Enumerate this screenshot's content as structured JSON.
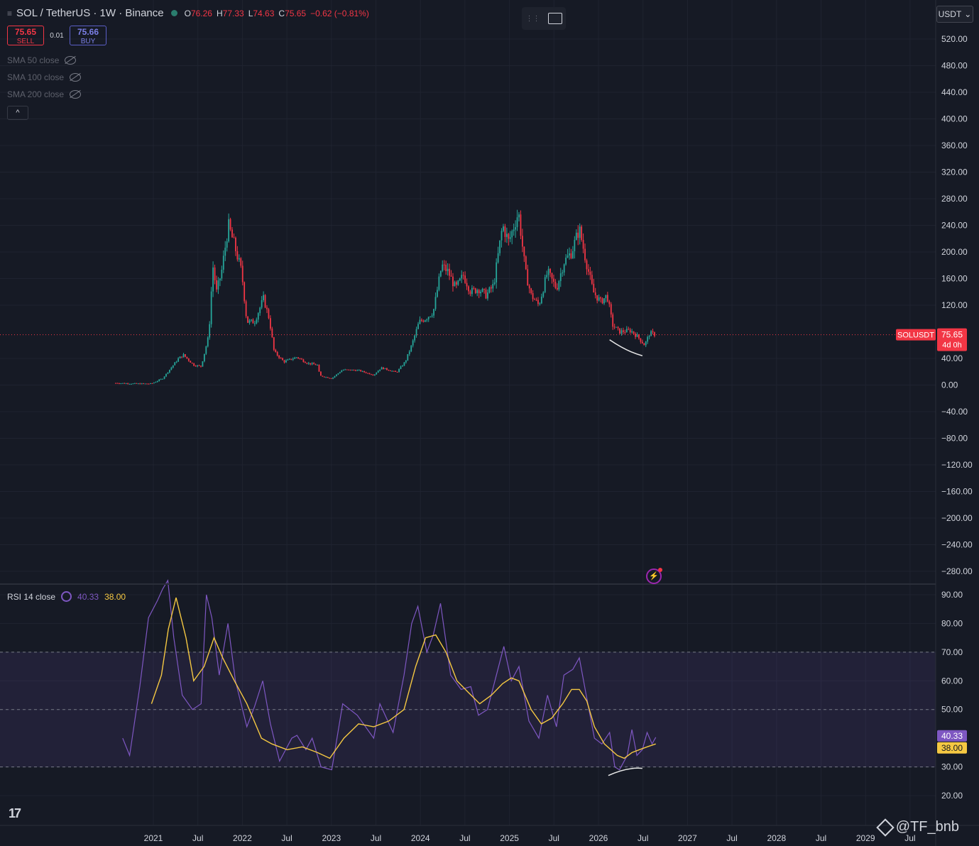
{
  "header": {
    "symbol": "SOL / TetherUS · 1W · Binance",
    "open_label": "O",
    "open": "76.26",
    "high_label": "H",
    "high": "77.33",
    "low_label": "L",
    "low": "74.63",
    "close_label": "C",
    "close": "75.65",
    "change": "−0.62 (−0.81%)"
  },
  "trade": {
    "sell_price": "75.65",
    "sell_label": "SELL",
    "spread": "0.01",
    "buy_price": "75.66",
    "buy_label": "BUY"
  },
  "indicators": [
    {
      "label": "SMA 50 close"
    },
    {
      "label": "SMA 100 close"
    },
    {
      "label": "SMA 200 close"
    }
  ],
  "collapse_glyph": "^",
  "currency": "USDT",
  "currency_glyph": "⌄",
  "rsi_header": {
    "name": "RSI 14 close",
    "value": "40.33",
    "ma_value": "38.00"
  },
  "price_tag": {
    "symbol": "SOLUSDT",
    "price": "75.65",
    "countdown": "4d 0h"
  },
  "watermark": "@TF_bnb",
  "tv_logo": "17",
  "colors": {
    "up": "#26a69a",
    "down": "#f23645",
    "rsi": "#7e57c2",
    "rsi_ma": "#f5c842",
    "bg": "#161a25"
  },
  "chart_data": [
    {
      "type": "candlestick",
      "axis": {
        "price_ticks": [
          "520.00",
          "480.00",
          "440.00",
          "400.00",
          "360.00",
          "320.00",
          "280.00",
          "240.00",
          "200.00",
          "160.00",
          "120.00",
          "40.00",
          "0.00",
          "−40.00",
          "−80.00",
          "−120.00",
          "−160.00",
          "−200.00",
          "−240.00",
          "−280.00"
        ],
        "ylim": [
          -300,
          540
        ],
        "time_ticks": [
          "2021",
          "Jul",
          "2022",
          "Jul",
          "2023",
          "Jul",
          "2024",
          "Jul",
          "2025",
          "Jul",
          "2026",
          "Jul",
          "2027",
          "Jul",
          "2028",
          "Jul",
          "2029",
          "Jul"
        ]
      },
      "x_start": "2020-08-10",
      "x_end": "2030-01-01",
      "weekly_close_anchors": [
        [
          "2020-08-10",
          3
        ],
        [
          "2020-11-01",
          2
        ],
        [
          "2021-01-01",
          2
        ],
        [
          "2021-02-15",
          10
        ],
        [
          "2021-04-20",
          40
        ],
        [
          "2021-05-10",
          45
        ],
        [
          "2021-06-20",
          30
        ],
        [
          "2021-07-20",
          28
        ],
        [
          "2021-08-20",
          75
        ],
        [
          "2021-09-05",
          180
        ],
        [
          "2021-09-20",
          140
        ],
        [
          "2021-10-10",
          170
        ],
        [
          "2021-11-07",
          240
        ],
        [
          "2021-12-01",
          210
        ],
        [
          "2021-12-30",
          170
        ],
        [
          "2022-01-20",
          95
        ],
        [
          "2022-02-20",
          95
        ],
        [
          "2022-03-28",
          130
        ],
        [
          "2022-04-20",
          100
        ],
        [
          "2022-05-10",
          50
        ],
        [
          "2022-06-18",
          35
        ],
        [
          "2022-08-10",
          42
        ],
        [
          "2022-09-20",
          33
        ],
        [
          "2022-11-01",
          30
        ],
        [
          "2022-11-10",
          14
        ],
        [
          "2022-12-28",
          10
        ],
        [
          "2023-02-10",
          23
        ],
        [
          "2023-04-15",
          22
        ],
        [
          "2023-06-15",
          15
        ],
        [
          "2023-07-15",
          26
        ],
        [
          "2023-09-15",
          19
        ],
        [
          "2023-10-20",
          35
        ],
        [
          "2023-11-15",
          60
        ],
        [
          "2023-12-15",
          95
        ],
        [
          "2024-01-10",
          100
        ],
        [
          "2024-02-10",
          110
        ],
        [
          "2024-03-15",
          180
        ],
        [
          "2024-04-10",
          170
        ],
        [
          "2024-05-10",
          145
        ],
        [
          "2024-06-10",
          165
        ],
        [
          "2024-07-10",
          140
        ],
        [
          "2024-08-10",
          145
        ],
        [
          "2024-09-10",
          135
        ],
        [
          "2024-10-10",
          150
        ],
        [
          "2024-11-15",
          240
        ],
        [
          "2024-12-10",
          215
        ],
        [
          "2025-01-18",
          260
        ],
        [
          "2025-02-15",
          170
        ],
        [
          "2025-03-10",
          135
        ],
        [
          "2025-04-10",
          120
        ],
        [
          "2025-05-15",
          170
        ],
        [
          "2025-06-20",
          145
        ],
        [
          "2025-07-20",
          185
        ],
        [
          "2025-08-20",
          200
        ],
        [
          "2025-09-20",
          235
        ],
        [
          "2025-10-15",
          190
        ],
        [
          "2025-11-15",
          140
        ],
        [
          "2025-12-15",
          125
        ],
        [
          "2026-01-10",
          135
        ],
        [
          "2026-02-01",
          90
        ],
        [
          "2026-03-01",
          80
        ],
        [
          "2026-04-15",
          82
        ],
        [
          "2026-05-15",
          72
        ],
        [
          "2026-06-10",
          60
        ],
        [
          "2026-07-01",
          78
        ],
        [
          "2026-07-25",
          75.65
        ]
      ],
      "annotation": "trendline below recent lows"
    },
    {
      "type": "line",
      "title": "RSI 14 close",
      "axis": {
        "ticks": [
          "90.00",
          "80.00",
          "70.00",
          "60.00",
          "50.00",
          "30.00",
          "20.00"
        ],
        "ylim": [
          14,
          94
        ],
        "bands": [
          30,
          50,
          70
        ]
      },
      "series": [
        {
          "name": "RSI",
          "color": "#7e57c2",
          "points": [
            [
              "2020-09-07",
              40
            ],
            [
              "2020-10-05",
              34
            ],
            [
              "2020-11-15",
              58
            ],
            [
              "2020-12-20",
              82
            ],
            [
              "2021-01-25",
              88
            ],
            [
              "2021-02-15",
              92
            ],
            [
              "2021-03-08",
              95
            ],
            [
              "2021-04-01",
              75
            ],
            [
              "2021-05-05",
              55
            ],
            [
              "2021-06-15",
              50
            ],
            [
              "2021-07-20",
              52
            ],
            [
              "2021-08-10",
              90
            ],
            [
              "2021-09-01",
              82
            ],
            [
              "2021-10-01",
              62
            ],
            [
              "2021-11-05",
              80
            ],
            [
              "2021-12-05",
              60
            ],
            [
              "2022-01-20",
              44
            ],
            [
              "2022-02-20",
              51
            ],
            [
              "2022-03-25",
              60
            ],
            [
              "2022-04-25",
              45
            ],
            [
              "2022-06-01",
              32
            ],
            [
              "2022-07-20",
              40
            ],
            [
              "2022-08-10",
              41
            ],
            [
              "2022-09-15",
              36
            ],
            [
              "2022-10-10",
              40
            ],
            [
              "2022-11-15",
              30
            ],
            [
              "2022-12-28",
              29
            ],
            [
              "2023-02-10",
              52
            ],
            [
              "2023-04-10",
              48
            ],
            [
              "2023-06-15",
              40
            ],
            [
              "2023-07-10",
              52
            ],
            [
              "2023-09-01",
              42
            ],
            [
              "2023-10-15",
              62
            ],
            [
              "2023-11-15",
              80
            ],
            [
              "2023-12-10",
              86
            ],
            [
              "2024-01-15",
              70
            ],
            [
              "2024-02-10",
              76
            ],
            [
              "2024-03-10",
              87
            ],
            [
              "2024-04-20",
              62
            ],
            [
              "2024-06-01",
              57
            ],
            [
              "2024-07-10",
              58
            ],
            [
              "2024-08-10",
              48
            ],
            [
              "2024-09-15",
              50
            ],
            [
              "2024-10-15",
              60
            ],
            [
              "2024-11-20",
              72
            ],
            [
              "2024-12-20",
              60
            ],
            [
              "2025-01-20",
              65
            ],
            [
              "2025-03-01",
              46
            ],
            [
              "2025-04-10",
              40
            ],
            [
              "2025-05-15",
              55
            ],
            [
              "2025-06-20",
              44
            ],
            [
              "2025-07-20",
              62
            ],
            [
              "2025-08-25",
              64
            ],
            [
              "2025-09-20",
              68
            ],
            [
              "2025-10-20",
              54
            ],
            [
              "2025-11-20",
              40
            ],
            [
              "2025-12-20",
              38
            ],
            [
              "2026-01-20",
              42
            ],
            [
              "2026-02-10",
              30
            ],
            [
              "2026-03-01",
              29
            ],
            [
              "2026-04-01",
              34
            ],
            [
              "2026-04-20",
              43
            ],
            [
              "2026-05-10",
              34
            ],
            [
              "2026-06-01",
              36
            ],
            [
              "2026-06-20",
              42
            ],
            [
              "2026-07-10",
              38
            ],
            [
              "2026-07-25",
              40.33
            ]
          ]
        },
        {
          "name": "RSI-based MA",
          "color": "#f5c842",
          "points": [
            [
              "2021-01-01",
              52
            ],
            [
              "2021-02-10",
              62
            ],
            [
              "2021-03-10",
              78
            ],
            [
              "2021-04-10",
              89
            ],
            [
              "2021-05-20",
              75
            ],
            [
              "2021-06-20",
              60
            ],
            [
              "2021-08-01",
              65
            ],
            [
              "2021-09-10",
              75
            ],
            [
              "2021-10-15",
              68
            ],
            [
              "2021-12-01",
              60
            ],
            [
              "2022-01-20",
              52
            ],
            [
              "2022-03-20",
              40
            ],
            [
              "2022-05-01",
              38
            ],
            [
              "2022-07-01",
              36
            ],
            [
              "2022-09-01",
              37
            ],
            [
              "2022-11-01",
              35
            ],
            [
              "2022-12-20",
              33
            ],
            [
              "2023-02-15",
              40
            ],
            [
              "2023-04-15",
              45
            ],
            [
              "2023-06-15",
              44
            ],
            [
              "2023-08-15",
              46
            ],
            [
              "2023-10-15",
              50
            ],
            [
              "2023-12-01",
              65
            ],
            [
              "2024-01-10",
              75
            ],
            [
              "2024-02-20",
              76
            ],
            [
              "2024-04-01",
              70
            ],
            [
              "2024-05-15",
              60
            ],
            [
              "2024-06-30",
              56
            ],
            [
              "2024-08-15",
              52
            ],
            [
              "2024-10-01",
              55
            ],
            [
              "2024-11-15",
              59
            ],
            [
              "2024-12-20",
              61
            ],
            [
              "2025-01-20",
              60
            ],
            [
              "2025-03-10",
              50
            ],
            [
              "2025-04-20",
              45
            ],
            [
              "2025-06-01",
              47
            ],
            [
              "2025-07-15",
              52
            ],
            [
              "2025-08-20",
              57
            ],
            [
              "2025-09-20",
              57
            ],
            [
              "2025-10-20",
              53
            ],
            [
              "2025-11-20",
              44
            ],
            [
              "2025-12-30",
              38
            ],
            [
              "2026-02-20",
              34
            ],
            [
              "2026-03-20",
              33
            ],
            [
              "2026-04-20",
              35
            ],
            [
              "2026-05-20",
              36
            ],
            [
              "2026-06-20",
              37
            ],
            [
              "2026-07-25",
              38
            ]
          ]
        }
      ],
      "annotation": "curve below RSI lows"
    }
  ]
}
